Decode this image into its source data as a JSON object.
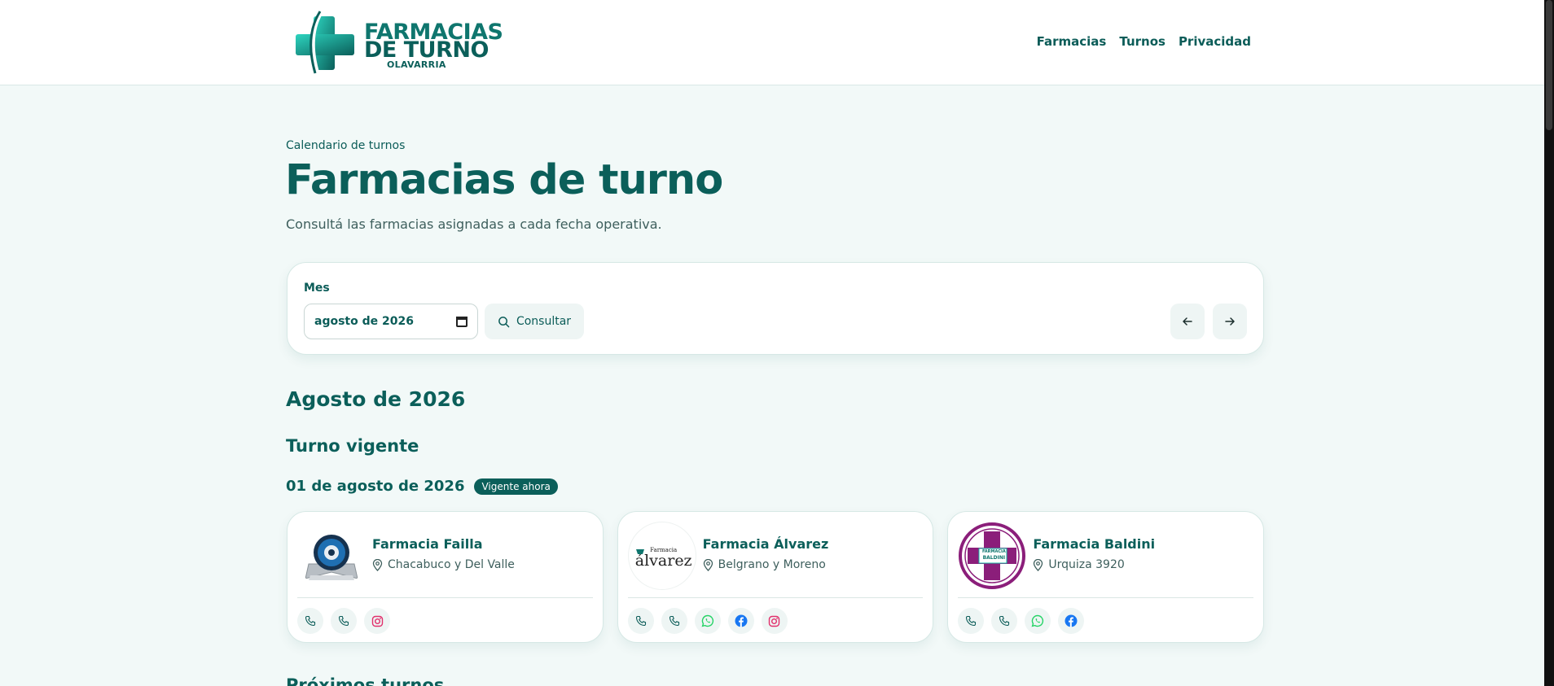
{
  "header": {
    "logo_line1": "FARMACIAS",
    "logo_line2": "DE TURNO",
    "logo_city": "OLAVARRIA",
    "nav": [
      "Farmacias",
      "Turnos",
      "Privacidad"
    ]
  },
  "hero": {
    "eyebrow": "Calendario de turnos",
    "title": "Farmacias de turno",
    "lead": "Consultá las farmacias asignadas a cada fecha operativa."
  },
  "filter": {
    "label": "Mes",
    "month_value": "agosto de 2026",
    "consult_label": "Consultar",
    "prev_icon": "arrow-left-icon",
    "next_icon": "arrow-right-icon"
  },
  "month_title": "Agosto de 2026",
  "current": {
    "section_title": "Turno vigente",
    "date": "01 de agosto de 2026",
    "badge": "Vigente ahora"
  },
  "pharmacies": [
    {
      "name": "Farmacia Failla",
      "address": "Chacabuco y Del Valle",
      "actions": [
        "phone",
        "phone",
        "instagram"
      ]
    },
    {
      "name": "Farmacia Álvarez",
      "address": "Belgrano y Moreno",
      "logo_text_small": "Farmacia",
      "logo_text": "álvarez",
      "actions": [
        "phone",
        "phone",
        "whatsapp",
        "facebook",
        "instagram"
      ]
    },
    {
      "name": "Farmacia Baldini",
      "address": "Urquiza 3920",
      "logo_text_small": "FARMACIA",
      "logo_text": "BALDINI",
      "actions": [
        "phone",
        "phone",
        "whatsapp",
        "facebook"
      ]
    }
  ],
  "next_section_title": "Próximos turnos",
  "colors": {
    "brand": "#0b5f5a",
    "accent": "#14b8a6",
    "background": "#f2f9f8",
    "whatsapp": "#25d366",
    "facebook": "#1877f2",
    "instagram": "#e1306c",
    "baldini": "#8b1e7a"
  }
}
